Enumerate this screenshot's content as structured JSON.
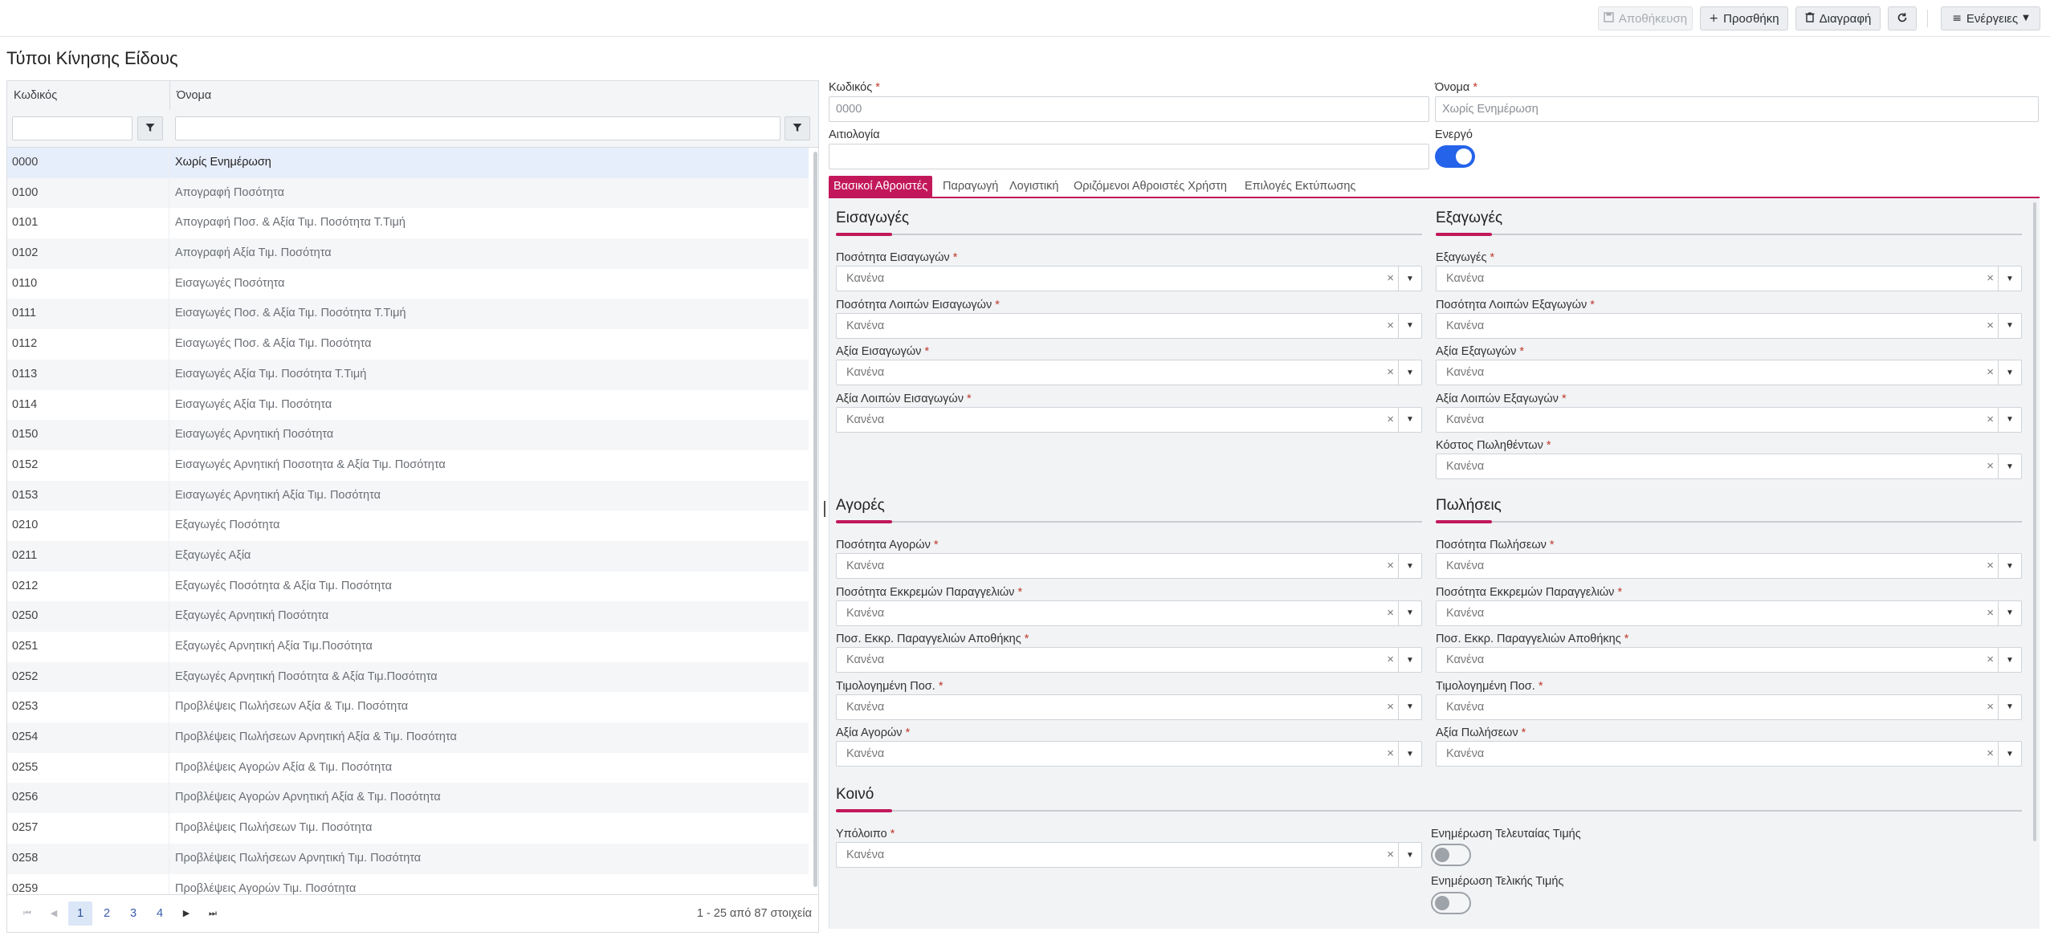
{
  "toolbar": {
    "save_label": "Αποθήκευση",
    "add_label": "Προσθήκη",
    "delete_label": "Διαγραφή",
    "actions_label": "Ενέργειες"
  },
  "page": {
    "title": "Τύποι Κίνησης Είδους"
  },
  "grid": {
    "headers": {
      "code": "Κωδικός",
      "name": "Όνομα"
    },
    "rows": [
      {
        "code": "0000",
        "name": "Χωρίς Ενημέρωση"
      },
      {
        "code": "0100",
        "name": "Απογραφή Ποσότητα"
      },
      {
        "code": "0101",
        "name": "Απογραφή Ποσ. & Αξία Τιμ. Ποσότητα Τ.Τιμή"
      },
      {
        "code": "0102",
        "name": "Απογραφή Αξία Τιμ. Ποσότητα"
      },
      {
        "code": "0110",
        "name": "Εισαγωγές Ποσότητα"
      },
      {
        "code": "0111",
        "name": "Εισαγωγές Ποσ. & Αξία Τιμ. Ποσότητα Τ.Τιμή"
      },
      {
        "code": "0112",
        "name": "Εισαγωγές Ποσ. & Αξία Τιμ. Ποσότητα"
      },
      {
        "code": "0113",
        "name": "Εισαγωγές Αξία Τιμ. Ποσότητα Τ.Τιμή"
      },
      {
        "code": "0114",
        "name": "Εισαγωγές Αξία Τιμ. Ποσότητα"
      },
      {
        "code": "0150",
        "name": "Εισαγωγές Αρνητική Ποσότητα"
      },
      {
        "code": "0152",
        "name": "Εισαγωγές Αρνητική Ποσοτητα & Αξία Τιμ. Ποσότητα"
      },
      {
        "code": "0153",
        "name": "Εισαγωγές Αρνητική Αξία Τιμ. Ποσότητα"
      },
      {
        "code": "0210",
        "name": "Εξαγωγές Ποσότητα"
      },
      {
        "code": "0211",
        "name": "Εξαγωγές Αξία"
      },
      {
        "code": "0212",
        "name": "Εξαγωγές Ποσότητα & Αξία Τιμ. Ποσότητα"
      },
      {
        "code": "0250",
        "name": "Εξαγωγές Αρνητική Ποσότητα"
      },
      {
        "code": "0251",
        "name": "Εξαγωγές Αρνητική Αξία Τιμ.Ποσότητα"
      },
      {
        "code": "0252",
        "name": "Εξαγωγές Αρνητική Ποσότητα & Αξία Τιμ.Ποσότητα"
      },
      {
        "code": "0253",
        "name": "Προβλέψεις Πωλήσεων Αξία & Τιμ. Ποσότητα"
      },
      {
        "code": "0254",
        "name": "Προβλέψεις Πωλήσεων Αρνητική Αξία & Τιμ. Ποσότητα"
      },
      {
        "code": "0255",
        "name": "Προβλέψεις Αγορών Αξία & Τιμ. Ποσότητα"
      },
      {
        "code": "0256",
        "name": "Προβλέψεις Αγορών Αρνητική Αξία & Τιμ. Ποσότητα"
      },
      {
        "code": "0257",
        "name": "Προβλέψεις Πωλήσεων Τιμ. Ποσότητα"
      },
      {
        "code": "0258",
        "name": "Προβλέψεις Πωλήσεων Αρνητική Τιμ. Ποσότητα"
      },
      {
        "code": "0259",
        "name": "Προβλέψεις Αγορών Τιμ. Ποσότητα"
      }
    ],
    "pager": {
      "pages": [
        "1",
        "2",
        "3",
        "4"
      ],
      "current": "1",
      "info": "1 - 25 από 87 στοιχεία"
    }
  },
  "form": {
    "code_label": "Κωδικός",
    "code_value": "0000",
    "name_label": "Όνομα",
    "name_value": "Χωρίς Ενημέρωση",
    "reason_label": "Αιτιολογία",
    "reason_value": "",
    "active_label": "Ενεργό",
    "active": true,
    "req_mark": "*"
  },
  "tabs": [
    "Βασικοί Αθροιστές",
    "Παραγωγή",
    "Λογιστική",
    "Οριζόμενοι Αθροιστές Χρήστη",
    "Επιλογές Εκτύπωσης"
  ],
  "select_placeholder": "Κανένα",
  "sections": {
    "imports": {
      "title": "Εισαγωγές",
      "fields": [
        "Ποσότητα Εισαγωγών",
        "Ποσότητα Λοιπών Εισαγωγών",
        "Αξία Εισαγωγών",
        "Αξία Λοιπών Εισαγωγών"
      ]
    },
    "exports": {
      "title": "Εξαγωγές",
      "fields": [
        "Εξαγωγές",
        "Ποσότητα Λοιπών Εξαγωγών",
        "Αξία Εξαγωγών",
        "Αξία Λοιπών Εξαγωγών",
        "Κόστος Πωληθέντων"
      ]
    },
    "purchases": {
      "title": "Αγορές",
      "fields": [
        "Ποσότητα Αγορών",
        "Ποσότητα Εκκρεμών Παραγγελιών",
        "Ποσ. Εκκρ. Παραγγελιών Αποθήκης",
        "Τιμολογημένη Ποσ.",
        "Αξία Αγορών"
      ]
    },
    "sales": {
      "title": "Πωλήσεις",
      "fields": [
        "Ποσότητα Πωλήσεων",
        "Ποσότητα Εκκρεμών Παραγγελιών",
        "Ποσ. Εκκρ. Παραγγελιών Αποθήκης",
        "Τιμολογημένη Ποσ.",
        "Αξία Πωλήσεων"
      ]
    },
    "common": {
      "title": "Κοινό",
      "balance_label": "Υπόλοιπο",
      "last_price_label": "Ενημέρωση Τελευταίας Τιμής",
      "final_price_label": "Ενημέρωση Τελικής Τιμής",
      "last_price_on": false,
      "final_price_on": false
    }
  },
  "icons": {
    "save": "save-icon",
    "add": "plus-icon",
    "delete": "trash-icon",
    "refresh": "refresh-icon",
    "menu": "menu-icon",
    "filter": "filter-icon"
  },
  "colors": {
    "accent": "#c2185b",
    "toggle_on": "#2563eb",
    "selected_row": "#e7eefb"
  }
}
